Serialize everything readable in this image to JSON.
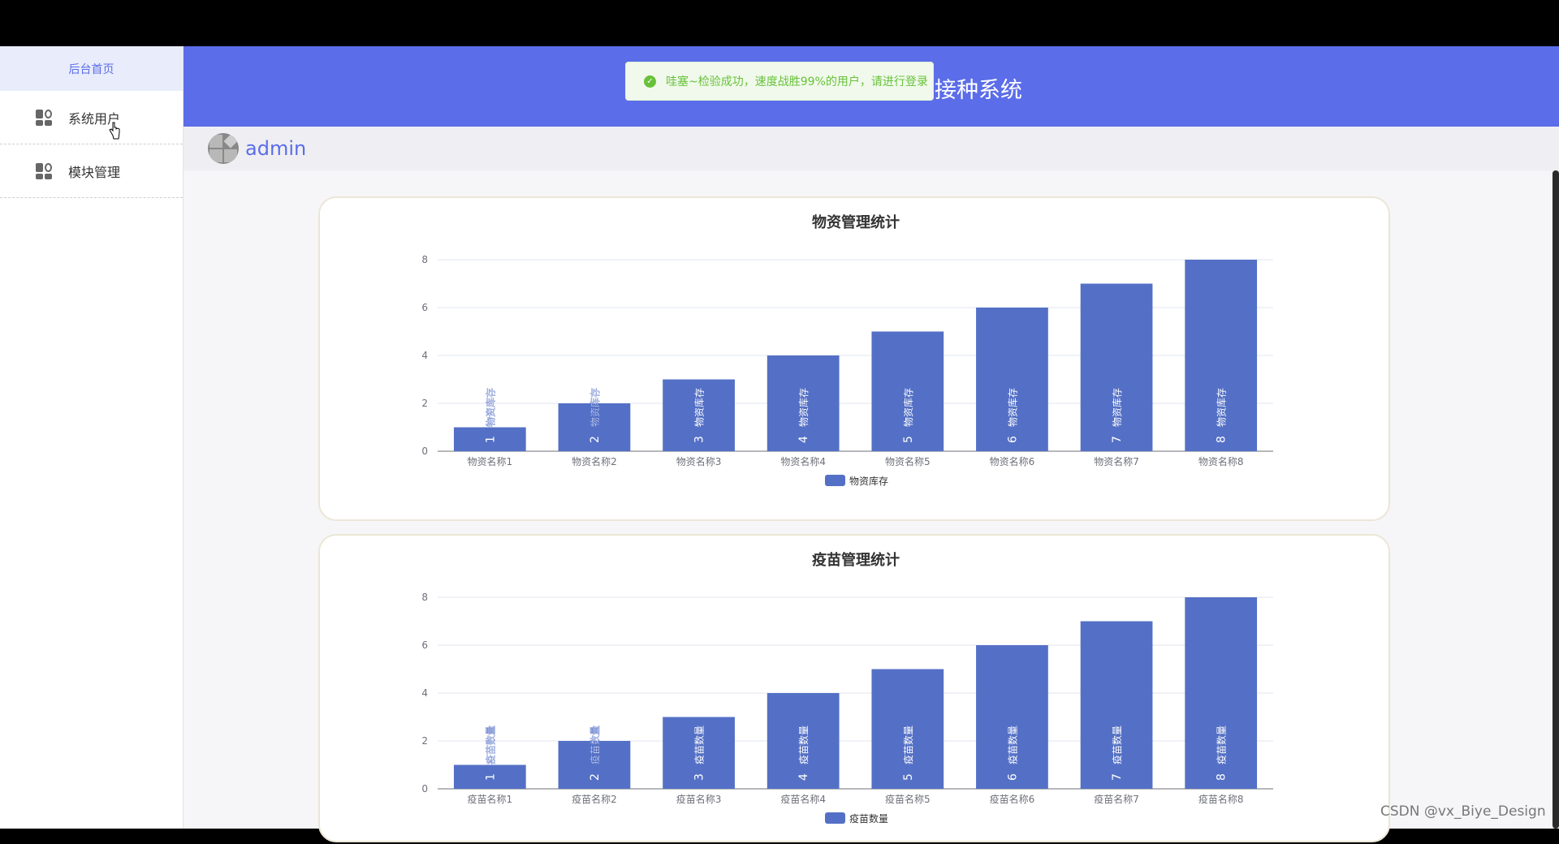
{
  "sidebar": {
    "home": "后台首页",
    "items": [
      {
        "label": "系统用户",
        "icon": "grid-icon"
      },
      {
        "label": "模块管理",
        "icon": "grid-icon"
      }
    ]
  },
  "header": {
    "title": "接种系统"
  },
  "toast": {
    "message": "哇塞~检验成功，速度战胜99%的用户，请进行登录"
  },
  "user": {
    "name": "admin"
  },
  "watermark": "CSDN @vx_Biye_Design",
  "colors": {
    "header": "#5b6de8",
    "bar": "#5470c6",
    "success": "#67c23a"
  },
  "chart_data": [
    {
      "type": "bar",
      "title": "物资管理统计",
      "categories": [
        "物资名称1",
        "物资名称2",
        "物资名称3",
        "物资名称4",
        "物资名称5",
        "物资名称6",
        "物资名称7",
        "物资名称8"
      ],
      "series": [
        {
          "name": "物资库存",
          "values": [
            1,
            2,
            3,
            4,
            5,
            6,
            7,
            8
          ]
        }
      ],
      "ylim": [
        0,
        8
      ],
      "yticks": [
        0,
        2,
        4,
        6,
        8
      ],
      "grid": true,
      "legend_position": "bottom-center"
    },
    {
      "type": "bar",
      "title": "疫苗管理统计",
      "categories": [
        "疫苗名称1",
        "疫苗名称2",
        "疫苗名称3",
        "疫苗名称4",
        "疫苗名称5",
        "疫苗名称6",
        "疫苗名称7",
        "疫苗名称8"
      ],
      "series": [
        {
          "name": "疫苗数量",
          "values": [
            1,
            2,
            3,
            4,
            5,
            6,
            7,
            8
          ]
        }
      ],
      "ylim": [
        0,
        8
      ],
      "yticks": [
        0,
        2,
        4,
        6,
        8
      ],
      "grid": true,
      "legend_position": "bottom-center"
    }
  ]
}
